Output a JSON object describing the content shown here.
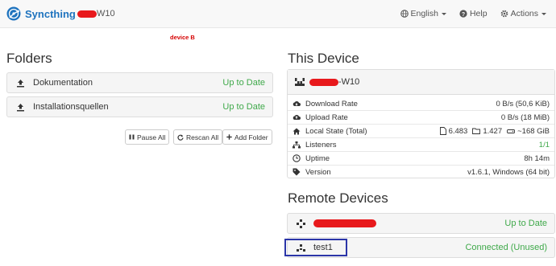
{
  "app": {
    "brand": "Syncthing",
    "device_name_suffix": "W10"
  },
  "nav": {
    "language": "English",
    "help": "Help",
    "actions": "Actions"
  },
  "annotation": "device B",
  "folders": {
    "heading": "Folders",
    "items": [
      {
        "label": "Dokumentation",
        "status": "Up to Date"
      },
      {
        "label": "Installationsquellen",
        "status": "Up to Date"
      }
    ],
    "buttons": {
      "pause_all": "Pause All",
      "rescan_all": "Rescan All",
      "add_folder": "Add Folder"
    }
  },
  "this_device": {
    "heading": "This Device",
    "name_suffix": "-W10",
    "rows": [
      {
        "label": "Download Rate",
        "value": "0 B/s (50,6 KiB)"
      },
      {
        "label": "Upload Rate",
        "value": "0 B/s (18 MiB)"
      },
      {
        "label": "Local State (Total)",
        "files": "6.483",
        "dirs": "1.427",
        "size": "~168 GiB"
      },
      {
        "label": "Listeners",
        "value": "1/1"
      },
      {
        "label": "Uptime",
        "value": "8h 14m"
      },
      {
        "label": "Version",
        "value": "v1.6.1, Windows (64 bit)"
      }
    ]
  },
  "remote_devices": {
    "heading": "Remote Devices",
    "items": [
      {
        "label": "",
        "status": "Up to Date"
      },
      {
        "label": "test1",
        "status": "Connected (Unused)"
      }
    ]
  },
  "colors": {
    "status_green": "#3fa94a",
    "brand_blue": "#1e73be",
    "redaction_red": "#e8191c",
    "highlight_blue": "#2b35a8"
  }
}
